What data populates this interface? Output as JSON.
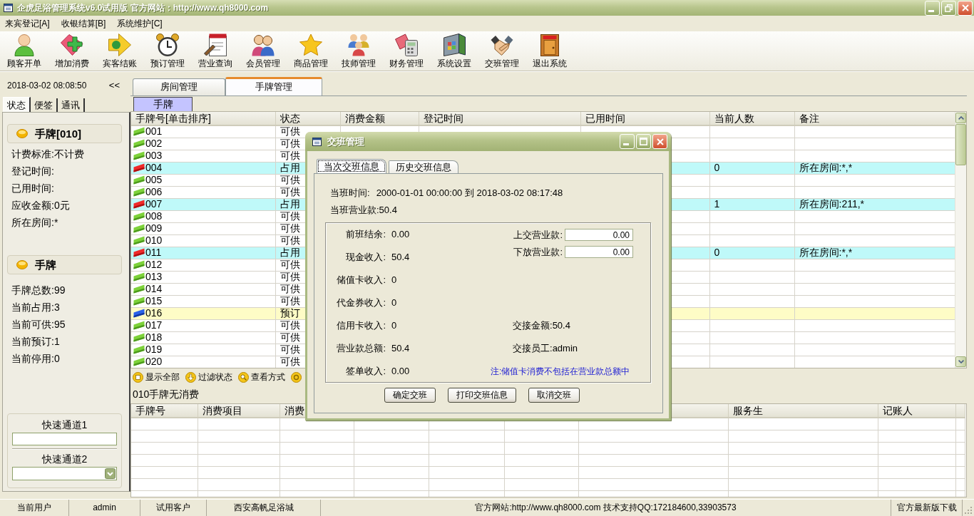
{
  "window": {
    "title": "企虎足浴管理系统v6.0试用版 官方网站：http://www.qh8000.com"
  },
  "menu": [
    "来宾登记[A]",
    "收银结算[B]",
    "系统维护[C]"
  ],
  "toolbar": [
    "顾客开单",
    "增加消费",
    "宾客结账",
    "预订管理",
    "营业查询",
    "会员管理",
    "商品管理",
    "技师管理",
    "财务管理",
    "系统设置",
    "交班管理",
    "退出系统"
  ],
  "left_panel": {
    "datetime": "2018-03-02 08:08:50",
    "collapse_button": "<<",
    "tabs": [
      {
        "label": "状态",
        "selected": true
      },
      {
        "label": "便签",
        "selected": false
      },
      {
        "label": "通讯",
        "selected": false
      }
    ],
    "groups": [
      {
        "title": "手牌[010]",
        "lines": [
          "计费标准:不计费",
          "登记时间:",
          "已用时间:",
          "应收金额:0元",
          "所在房间:*"
        ]
      },
      {
        "title": "手牌",
        "lines": [
          "手牌总数:99",
          "当前占用:3",
          "当前可供:95",
          "当前预订:1",
          "当前停用:0"
        ]
      }
    ],
    "quick_access": [
      {
        "label": "快速通道1",
        "kind": "input"
      },
      {
        "label": "快速通道2",
        "kind": "select"
      }
    ]
  },
  "main_tabs": [
    {
      "label": "房间管理",
      "selected": false
    },
    {
      "label": "手牌管理",
      "selected": true
    }
  ],
  "sub_tabs": [
    {
      "label": "手牌",
      "selected": true
    }
  ],
  "table": {
    "columns": [
      "手牌号[单击排序]",
      "状态",
      "消费金额",
      "登记时间",
      "已用时间",
      "当前人数",
      "备注"
    ],
    "rows": [
      {
        "number": "001",
        "status": "可供",
        "kind": "available"
      },
      {
        "number": "002",
        "status": "可供",
        "kind": "available"
      },
      {
        "number": "003",
        "status": "可供",
        "kind": "available"
      },
      {
        "number": "004",
        "status": "占用",
        "kind": "occupied",
        "people": "0",
        "note": "所在房间:*,*"
      },
      {
        "number": "005",
        "status": "可供",
        "kind": "available"
      },
      {
        "number": "006",
        "status": "可供",
        "kind": "available"
      },
      {
        "number": "007",
        "status": "占用",
        "kind": "occupied",
        "people": "1",
        "note": "所在房间:211,*"
      },
      {
        "number": "008",
        "status": "可供",
        "kind": "available"
      },
      {
        "number": "009",
        "status": "可供",
        "kind": "available"
      },
      {
        "number": "010",
        "status": "可供",
        "kind": "available"
      },
      {
        "number": "011",
        "status": "占用",
        "kind": "occupied",
        "people": "0",
        "note": "所在房间:*,*"
      },
      {
        "number": "012",
        "status": "可供",
        "kind": "available"
      },
      {
        "number": "013",
        "status": "可供",
        "kind": "available"
      },
      {
        "number": "014",
        "status": "可供",
        "kind": "available"
      },
      {
        "number": "015",
        "status": "可供",
        "kind": "available"
      },
      {
        "number": "016",
        "status": "预订",
        "kind": "reserved"
      },
      {
        "number": "017",
        "status": "可供",
        "kind": "available"
      },
      {
        "number": "018",
        "status": "可供",
        "kind": "available"
      },
      {
        "number": "019",
        "status": "可供",
        "kind": "available"
      },
      {
        "number": "020",
        "status": "可供",
        "kind": "available"
      }
    ]
  },
  "view_toolbar": [
    "显示全部",
    "过滤状态",
    "查看方式"
  ],
  "detail_caption": "010手牌无消费",
  "detail_table": {
    "columns": [
      {
        "label": "手牌号"
      },
      {
        "label": "消费项目"
      },
      {
        "label": "消费"
      },
      {},
      {},
      {},
      {},
      {
        "label": "服务生"
      },
      {
        "label": "记账人"
      }
    ]
  },
  "dialog": {
    "title": "交班管理",
    "tabs": [
      {
        "label": "当次交班信息",
        "selected": true
      },
      {
        "label": "历史交班信息",
        "selected": false
      }
    ],
    "shift_time": {
      "label": "当班时间:",
      "value": "2000-01-01 00:00:00 到 2018-03-02 08:17:48"
    },
    "shift_revenue": "当班营业款:50.4",
    "summary": [
      {
        "label": "前班结余:",
        "value": "0.00"
      },
      {
        "label": "现金收入:",
        "value": "50.4"
      },
      {
        "label": "储值卡收入:",
        "value": "0"
      },
      {
        "label": "代金券收入:",
        "value": "0"
      },
      {
        "label": "信用卡收入:",
        "value": "0"
      },
      {
        "label": "营业款总额:",
        "value": "50.4"
      },
      {
        "label": "签单收入:",
        "value": "0.00"
      }
    ],
    "inputs": [
      {
        "label": "上交营业款:",
        "value": "0.00"
      },
      {
        "label": "下放营业款:",
        "value": "0.00"
      }
    ],
    "handover": [
      {
        "label": "交接金额:",
        "value": "50.4"
      },
      {
        "label": "交接员工:",
        "value": "admin"
      }
    ],
    "note": "注:储值卡消费不包括在营业款总额中",
    "buttons": [
      "确定交班",
      "打印交班信息",
      "取消交班"
    ]
  },
  "status_bar": [
    "当前用户",
    "admin",
    "试用客户",
    "西安高帆足浴城",
    "官方网站:http://www.qh8000.com 技术支持QQ:172184600,33903573",
    "官方最新版下载"
  ]
}
